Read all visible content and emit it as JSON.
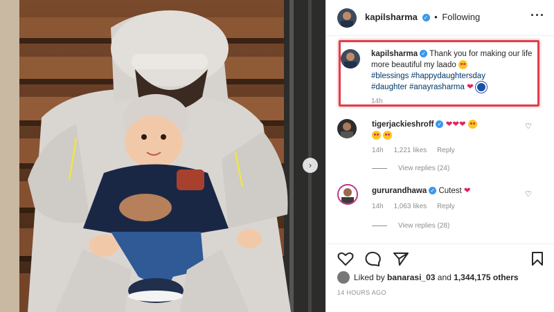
{
  "header": {
    "username": "kapilsharma",
    "separator": "•",
    "follow_status": "Following",
    "more_icon": "ellipsis-icon"
  },
  "caption": {
    "username": "kapilsharma",
    "text_1": "Thank you for making our life more beautiful my laado",
    "hashtags_1": "#blessings #happydaughtersday",
    "hashtags_2": "#daughter #anayrasharma",
    "time": "14h",
    "highlight_color": "#e23d4b"
  },
  "comments": [
    {
      "username": "tigerjackieshroff",
      "text": "",
      "time": "14h",
      "likes": "1,221 likes",
      "reply_label": "Reply",
      "view_replies": "View replies (24)"
    },
    {
      "username": "gururandhawa",
      "text": "Cutest",
      "time": "14h",
      "likes": "1,063 likes",
      "reply_label": "Reply",
      "view_replies": "View replies (28)"
    }
  ],
  "actions": {
    "icons": [
      "heart-icon",
      "comment-icon",
      "share-icon",
      "bookmark-icon"
    ]
  },
  "likes": {
    "prefix": "Liked by",
    "user": "banarasi_03",
    "conjunction": "and",
    "count": "1,344,175 others"
  },
  "timestamp": "14 HOURS AGO",
  "colors": {
    "verified": "#3897f0",
    "heart": "#e0245e",
    "hashtag": "#00376b",
    "meta": "#8e8e8e"
  }
}
